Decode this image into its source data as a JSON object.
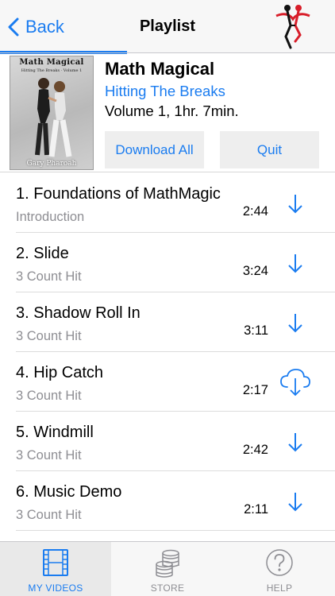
{
  "nav": {
    "back_label": "Back",
    "title": "Playlist"
  },
  "album": {
    "cover_title": "Math Magical",
    "cover_subtitle": "Hitting The Breaks · Volume 1",
    "cover_footer": "Gary Pharoah",
    "title": "Math Magical",
    "subtitle": "Hitting The Breaks",
    "info": "Volume 1, 1hr. 7min."
  },
  "buttons": {
    "download_all": "Download All",
    "quit": "Quit"
  },
  "tracks": [
    {
      "title": "1. Foundations of MathMagic",
      "subtitle": "Introduction",
      "duration": "2:44",
      "action": "download-arrow-icon"
    },
    {
      "title": "2. Slide",
      "subtitle": "3 Count Hit",
      "duration": "3:24",
      "action": "download-arrow-icon"
    },
    {
      "title": "3. Shadow Roll In",
      "subtitle": "3 Count Hit",
      "duration": "3:11",
      "action": "download-arrow-icon"
    },
    {
      "title": "4. Hip Catch",
      "subtitle": "3 Count Hit",
      "duration": "2:17",
      "action": "cloud-download-icon"
    },
    {
      "title": "5. Windmill",
      "subtitle": "3 Count Hit",
      "duration": "2:42",
      "action": "download-arrow-icon"
    },
    {
      "title": "6. Music Demo",
      "subtitle": "3 Count Hit",
      "duration": "2:11",
      "action": "download-arrow-icon"
    }
  ],
  "tabs": [
    {
      "label": "MY VIDEOS",
      "icon": "film-strip-icon",
      "active": true
    },
    {
      "label": "STORE",
      "icon": "coins-stack-icon",
      "active": false
    },
    {
      "label": "HELP",
      "icon": "help-circle-icon",
      "active": false
    }
  ],
  "colors": {
    "accent": "#1a7cf0",
    "secondary_text": "#8e8e93",
    "logo_red": "#d81e2a"
  }
}
